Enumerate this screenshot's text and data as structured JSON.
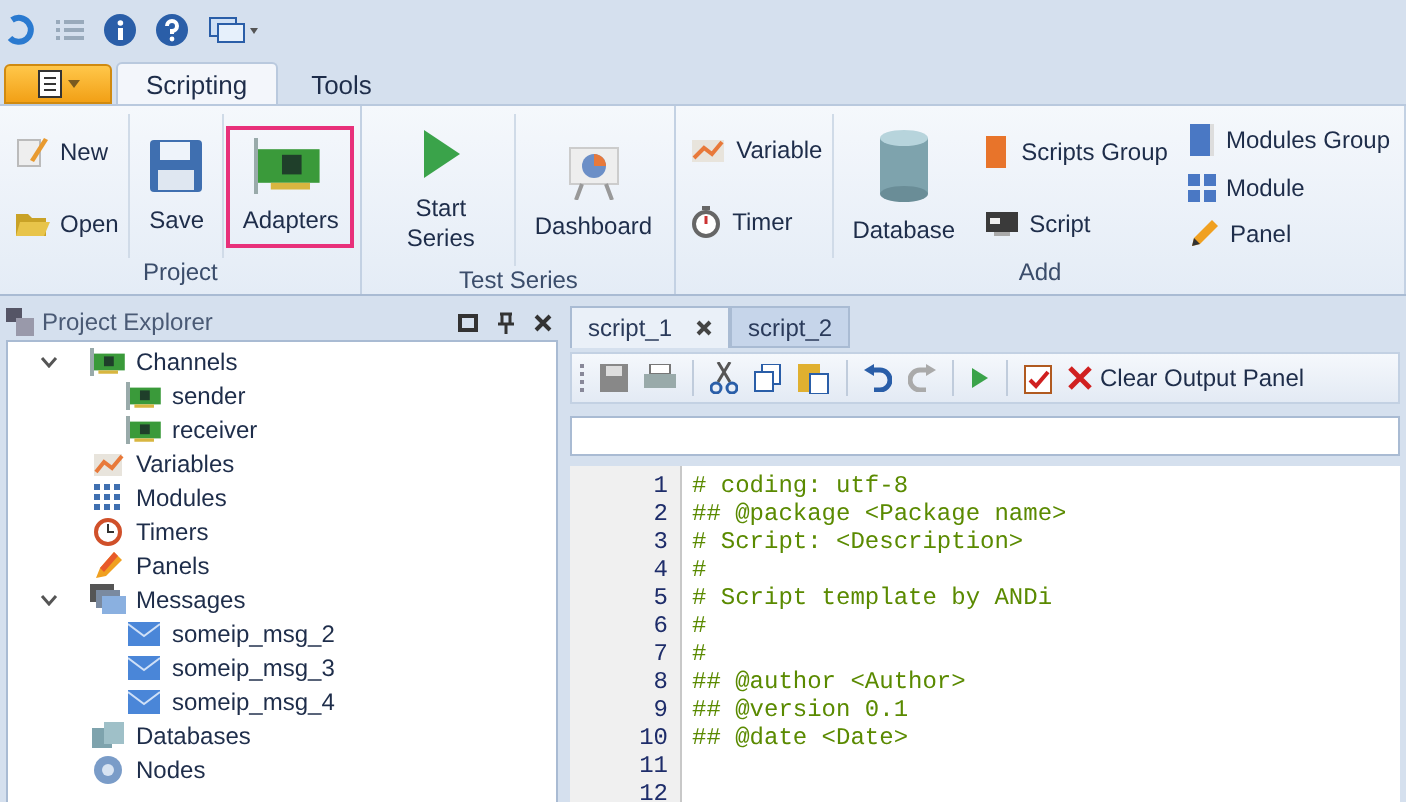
{
  "ribbon_tabs": [
    {
      "label": "Scripting",
      "selected": true
    },
    {
      "label": "Tools",
      "selected": false
    }
  ],
  "ribbon_groups": [
    {
      "label": "Project",
      "columns": [
        {
          "kind": "stack",
          "items": [
            {
              "label": "New",
              "highlighted": false
            },
            {
              "label": "Open",
              "highlighted": false
            }
          ]
        },
        {
          "kind": "large",
          "items": [
            {
              "label": "Save",
              "highlighted": false
            }
          ]
        },
        {
          "kind": "large",
          "items": [
            {
              "label": "Adapters",
              "highlighted": true
            }
          ]
        }
      ]
    },
    {
      "label": "Test Series",
      "columns": [
        {
          "kind": "large",
          "items": [
            {
              "label": "Start Series",
              "highlighted": false
            }
          ]
        },
        {
          "kind": "large",
          "items": [
            {
              "label": "Dashboard",
              "highlighted": false
            }
          ]
        }
      ]
    },
    {
      "label": "Add",
      "columns": [
        {
          "kind": "stack",
          "items": [
            {
              "label": "Variable",
              "highlighted": false
            },
            {
              "label": "Timer",
              "highlighted": false
            }
          ]
        },
        {
          "kind": "large",
          "items": [
            {
              "label": "Database",
              "highlighted": false
            }
          ]
        },
        {
          "kind": "stack",
          "items": [
            {
              "label": "Scripts Group",
              "highlighted": false
            },
            {
              "label": "Script",
              "highlighted": false
            }
          ]
        },
        {
          "kind": "stack",
          "items": [
            {
              "label": "Modules Group",
              "highlighted": false
            },
            {
              "label": "Module",
              "highlighted": false
            },
            {
              "label": "Panel",
              "highlighted": false
            }
          ]
        }
      ]
    }
  ],
  "project_explorer": {
    "title": "Project Explorer",
    "tree": [
      {
        "label": "Channels",
        "expanded": true,
        "children": [
          {
            "label": "sender"
          },
          {
            "label": "receiver"
          }
        ]
      },
      {
        "label": "Variables"
      },
      {
        "label": "Modules"
      },
      {
        "label": "Timers"
      },
      {
        "label": "Panels"
      },
      {
        "label": "Messages",
        "expanded": true,
        "children": [
          {
            "label": "someip_msg_2"
          },
          {
            "label": "someip_msg_3"
          },
          {
            "label": "someip_msg_4"
          }
        ]
      },
      {
        "label": "Databases"
      },
      {
        "label": "Nodes"
      }
    ]
  },
  "editor_tabs": [
    {
      "label": "script_1",
      "selected": true
    },
    {
      "label": "script_2",
      "selected": false
    }
  ],
  "toolbar": {
    "clear_button": "Clear Output Panel"
  },
  "code_lines": [
    {
      "number": "1",
      "text": "# coding: utf-8"
    },
    {
      "number": "2",
      "text": "## @package <Package name>"
    },
    {
      "number": "3",
      "text": "# Script: <Description>"
    },
    {
      "number": "4",
      "text": "#"
    },
    {
      "number": "5",
      "text": "# Script template by ANDi"
    },
    {
      "number": "6",
      "text": "#"
    },
    {
      "number": "7",
      "text": "#"
    },
    {
      "number": "8",
      "text": "## @author <Author>"
    },
    {
      "number": "9",
      "text": "## @version 0.1"
    },
    {
      "number": "10",
      "text": "## @date <Date>"
    },
    {
      "number": "11"
    },
    {
      "number": "12"
    }
  ]
}
